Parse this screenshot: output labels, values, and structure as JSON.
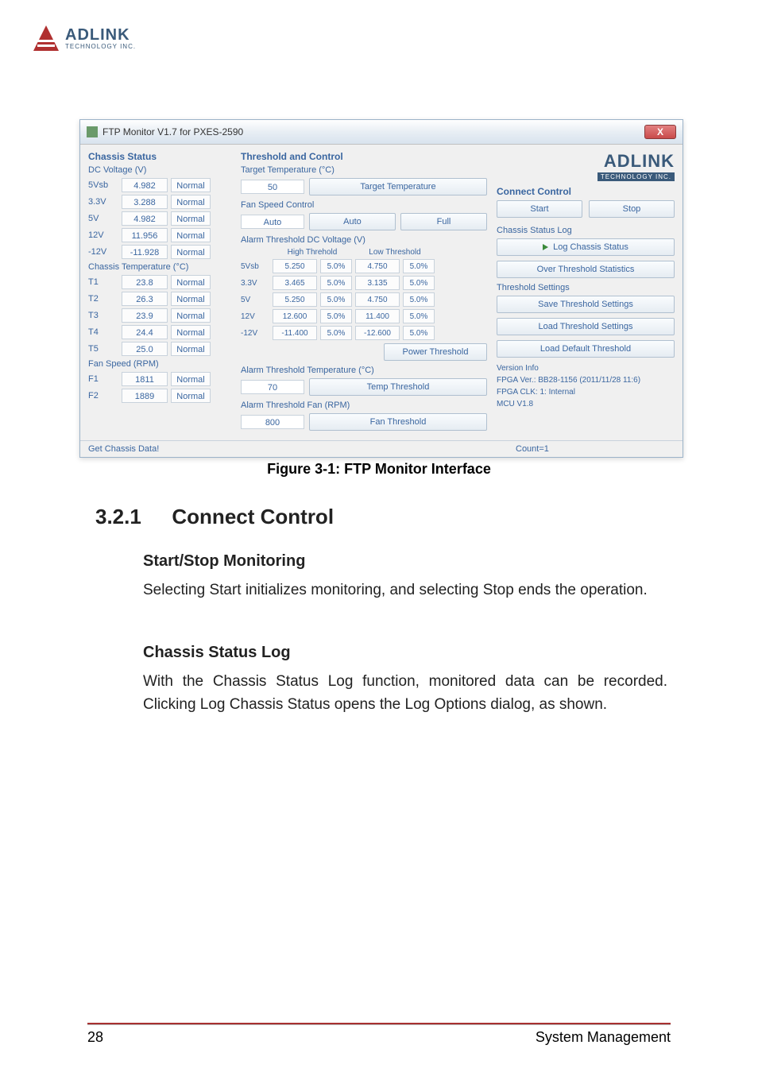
{
  "page_logo": {
    "brand": "ADLINK",
    "sub": "TECHNOLOGY INC."
  },
  "win": {
    "title": "FTP Monitor V1.7 for PXES-2590",
    "close": "X",
    "statusbar": {
      "left": "Get Chassis Data!",
      "right": "Count=1"
    }
  },
  "left": {
    "section": "Chassis Status",
    "dc_label": "DC Voltage (V)",
    "dc_rows": [
      {
        "name": "5Vsb",
        "val": "4.982",
        "state": "Normal"
      },
      {
        "name": "3.3V",
        "val": "3.288",
        "state": "Normal"
      },
      {
        "name": "5V",
        "val": "4.982",
        "state": "Normal"
      },
      {
        "name": "12V",
        "val": "11.956",
        "state": "Normal"
      },
      {
        "name": "-12V",
        "val": "-11.928",
        "state": "Normal"
      }
    ],
    "temp_label": "Chassis Temperature (°C)",
    "temp_rows": [
      {
        "name": "T1",
        "val": "23.8",
        "state": "Normal"
      },
      {
        "name": "T2",
        "val": "26.3",
        "state": "Normal"
      },
      {
        "name": "T3",
        "val": "23.9",
        "state": "Normal"
      },
      {
        "name": "T4",
        "val": "24.4",
        "state": "Normal"
      },
      {
        "name": "T5",
        "val": "25.0",
        "state": "Normal"
      }
    ],
    "fan_label": "Fan Speed (RPM)",
    "fan_rows": [
      {
        "name": "F1",
        "val": "1811",
        "state": "Normal"
      },
      {
        "name": "F2",
        "val": "1889",
        "state": "Normal"
      }
    ]
  },
  "mid": {
    "section": "Threshold and Control",
    "target_temp_label": "Target Temperature (°C)",
    "target_temp_val": "50",
    "target_temp_btn": "Target Temperature",
    "fan_ctrl_label": "Fan Speed Control",
    "fan_mode": "Auto",
    "fan_auto_btn": "Auto",
    "fan_full_btn": "Full",
    "alarm_dc_label": "Alarm Threshold DC Voltage (V)",
    "hi_hdr": "High Threhold",
    "lo_hdr": "Low Threshold",
    "rows": [
      {
        "name": "5Vsb",
        "hv": "5.250",
        "hp": "5.0%",
        "lv": "4.750",
        "lp": "5.0%"
      },
      {
        "name": "3.3V",
        "hv": "3.465",
        "hp": "5.0%",
        "lv": "3.135",
        "lp": "5.0%"
      },
      {
        "name": "5V",
        "hv": "5.250",
        "hp": "5.0%",
        "lv": "4.750",
        "lp": "5.0%"
      },
      {
        "name": "12V",
        "hv": "12.600",
        "hp": "5.0%",
        "lv": "11.400",
        "lp": "5.0%"
      },
      {
        "name": "-12V",
        "hv": "-11.400",
        "hp": "5.0%",
        "lv": "-12.600",
        "lp": "5.0%"
      }
    ],
    "power_btn": "Power Threshold",
    "alarm_temp_label": "Alarm Threshold Temperature (°C)",
    "alarm_temp_val": "70",
    "alarm_temp_btn": "Temp Threshold",
    "alarm_fan_label": "Alarm Threshold Fan (RPM)",
    "alarm_fan_val": "800",
    "alarm_fan_btn": "Fan Threshold"
  },
  "right": {
    "brand": "ADLINK",
    "brand_sub": "TECHNOLOGY INC.",
    "connect_label": "Connect Control",
    "start_btn": "Start",
    "stop_btn": "Stop",
    "log_label": "Chassis Status Log",
    "log_btn": "Log Chassis Status",
    "over_btn": "Over Threshold Statistics",
    "settings_label": "Threshold Settings",
    "save_btn": "Save Threshold Settings",
    "load_btn": "Load Threshold Settings",
    "default_btn": "Load Default Threshold",
    "version_label": "Version Info",
    "fpga_ver": "FPGA Ver.: BB28-1156 (2011/11/28 11:6)",
    "fpga_clk": "FPGA CLK: 1: Internal",
    "mcu": "MCU V1.8"
  },
  "caption": "Figure 3-1: FTP Monitor Interface",
  "doc": {
    "h2_num": "3.2.1",
    "h2": "Connect Control",
    "h3a": "Start/Stop Monitoring",
    "p1": "Selecting Start initializes monitoring, and selecting Stop ends the operation.",
    "h3b": "Chassis Status Log",
    "p2": "With the Chassis Status Log function, monitored data can be recorded. Clicking Log Chassis Status opens the Log Options dialog, as shown."
  },
  "footer": {
    "page": "28",
    "section": "System Management"
  }
}
